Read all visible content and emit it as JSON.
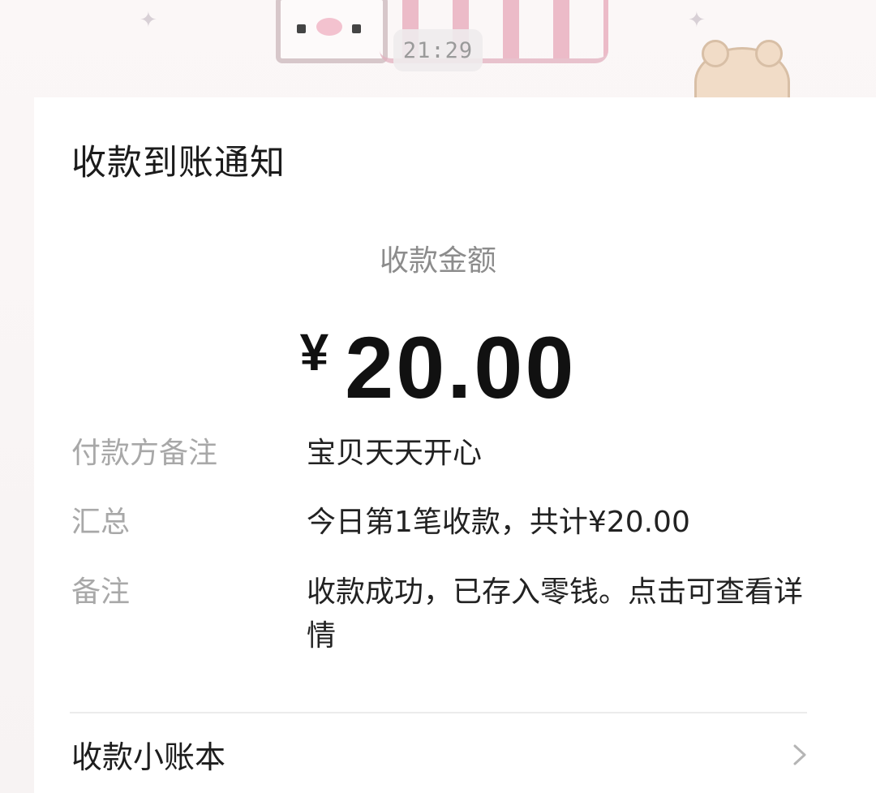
{
  "chat": {
    "timestamp": "21:29"
  },
  "notification": {
    "title": "收款到账通知",
    "amount_label": "收款金额",
    "currency_symbol": "¥",
    "amount": "20.00",
    "rows": [
      {
        "label": "付款方备注",
        "value": "宝贝天天开心"
      },
      {
        "label": "汇总",
        "value": "今日第1笔收款，共计¥20.00"
      },
      {
        "label": "备注",
        "value": "收款成功，已存入零钱。点击可查看详情"
      }
    ],
    "footer_link": "收款小账本",
    "footer_icon": "chevron-right-icon"
  },
  "colors": {
    "card_background": "#ffffff",
    "title": "#1b1b1b",
    "label": "#a8a8a8",
    "value": "#222222",
    "amount": "#111111"
  }
}
